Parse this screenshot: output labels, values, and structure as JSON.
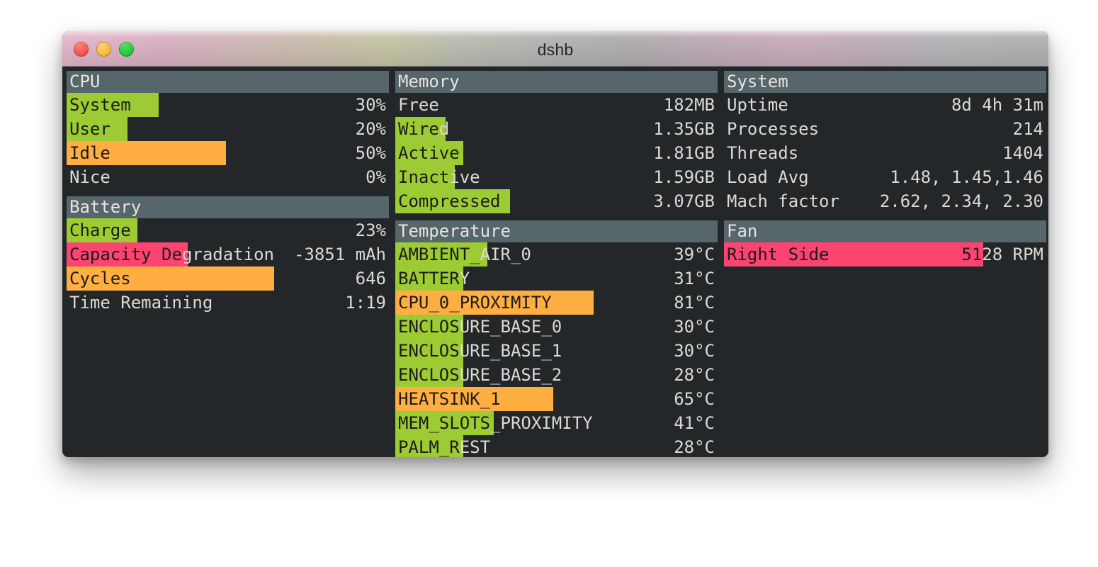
{
  "window": {
    "title": "dshb",
    "buttons": {
      "close": "close",
      "minimize": "minimize",
      "maximize": "maximize"
    }
  },
  "panels": {
    "cpu": {
      "title": "CPU",
      "rows": [
        {
          "label": "System",
          "value": "30%",
          "bar_pct": 28.5,
          "color": "#9ccb34"
        },
        {
          "label": "User",
          "value": "20%",
          "bar_pct": 19.0,
          "color": "#9ccb34"
        },
        {
          "label": "Idle",
          "value": "50%",
          "bar_pct": 49.5,
          "color": "#ffae42"
        },
        {
          "label": "Nice",
          "value": "0%",
          "bar_pct": 0,
          "color": "#9ccb34"
        }
      ]
    },
    "battery": {
      "title": "Battery",
      "rows": [
        {
          "label": "Charge",
          "value": "23%",
          "bar_pct": 22.0,
          "color": "#9ccb34"
        },
        {
          "label": "Capacity Degradation",
          "value": "-3851 mAh",
          "bar_pct": 37.5,
          "color": "#fb4570"
        },
        {
          "label": "Cycles",
          "value": "646",
          "bar_pct": 64.5,
          "color": "#ffae42"
        },
        {
          "label": "Time Remaining",
          "value": "1:19",
          "bar_pct": 0,
          "color": "#9ccb34"
        }
      ]
    },
    "memory": {
      "title": "Memory",
      "rows": [
        {
          "label": "Free",
          "value": "182MB",
          "bar_pct": 0,
          "color": "#9ccb34"
        },
        {
          "label": "Wired",
          "value": "1.35GB",
          "bar_pct": 15.5,
          "color": "#9ccb34"
        },
        {
          "label": "Active",
          "value": "1.81GB",
          "bar_pct": 21.0,
          "color": "#9ccb34"
        },
        {
          "label": "Inactive",
          "value": "1.59GB",
          "bar_pct": 18.5,
          "color": "#9ccb34"
        },
        {
          "label": "Compressed",
          "value": "3.07GB",
          "bar_pct": 35.5,
          "color": "#9ccb34"
        }
      ]
    },
    "temperature": {
      "title": "Temperature",
      "rows": [
        {
          "label": "AMBIENT_AIR_0",
          "value": "39°C",
          "bar_pct": 28.5,
          "color": "#9ccb34"
        },
        {
          "label": "BATTERY",
          "value": "31°C",
          "bar_pct": 21.0,
          "color": "#9ccb34"
        },
        {
          "label": "CPU_0_PROXIMITY",
          "value": "81°C",
          "bar_pct": 61.5,
          "color": "#ffae42"
        },
        {
          "label": "ENCLOSURE_BASE_0",
          "value": "30°C",
          "bar_pct": 21.0,
          "color": "#9ccb34"
        },
        {
          "label": "ENCLOSURE_BASE_1",
          "value": "30°C",
          "bar_pct": 21.0,
          "color": "#9ccb34"
        },
        {
          "label": "ENCLOSURE_BASE_2",
          "value": "28°C",
          "bar_pct": 21.0,
          "color": "#9ccb34"
        },
        {
          "label": "HEATSINK_1",
          "value": "65°C",
          "bar_pct": 49.0,
          "color": "#ffae42"
        },
        {
          "label": "MEM_SLOTS_PROXIMITY",
          "value": "41°C",
          "bar_pct": 30.5,
          "color": "#9ccb34"
        },
        {
          "label": "PALM_REST",
          "value": "28°C",
          "bar_pct": 21.0,
          "color": "#9ccb34"
        }
      ]
    },
    "system": {
      "title": "System",
      "rows": [
        {
          "label": "Uptime",
          "value": "8d 4h 31m",
          "bar_pct": 0,
          "color": "#9ccb34"
        },
        {
          "label": "Processes",
          "value": "214",
          "bar_pct": 0,
          "color": "#9ccb34"
        },
        {
          "label": "Threads",
          "value": "1404",
          "bar_pct": 0,
          "color": "#9ccb34"
        },
        {
          "label": "Load Avg",
          "value": "1.48, 1.45,1.46",
          "bar_pct": 0,
          "color": "#9ccb34"
        },
        {
          "label": "Mach factor",
          "value": "2.62, 2.34, 2.30",
          "bar_pct": 0,
          "color": "#9ccb34"
        }
      ]
    },
    "fan": {
      "title": "Fan",
      "rows": [
        {
          "label": "Right Side",
          "value": "5128 RPM",
          "bar_pct": 80.5,
          "color": "#fb4570"
        }
      ]
    }
  },
  "colors": {
    "green": "#9ccb34",
    "orange": "#ffae42",
    "pink": "#fb4570",
    "header_bg": "#56666b",
    "panel_bg": "#242729",
    "text": "#ddd9d3",
    "text_on_bar": "#1d1b1a"
  }
}
